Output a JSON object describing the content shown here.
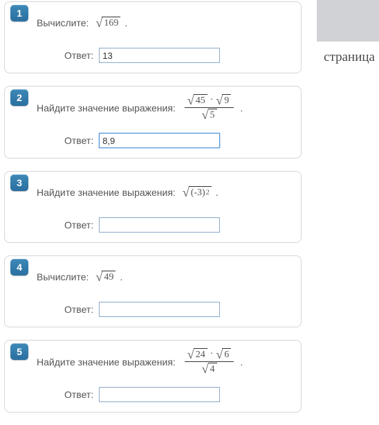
{
  "background": {
    "word": "страница"
  },
  "common": {
    "answer_label": "Ответ:"
  },
  "questions": [
    {
      "num": "1",
      "prompt": "Вычислите:",
      "formula": {
        "type": "sqrt",
        "arg": "169"
      },
      "answer": "13",
      "focused": false
    },
    {
      "num": "2",
      "prompt": "Найдите значение выражения:",
      "formula": {
        "type": "frac",
        "num": [
          {
            "type": "sqrt",
            "arg": "45"
          },
          {
            "type": "dot"
          },
          {
            "type": "sqrt",
            "arg": "9"
          }
        ],
        "den": [
          {
            "type": "sqrt",
            "arg": "5"
          }
        ]
      },
      "answer": "8,9",
      "focused": true
    },
    {
      "num": "3",
      "prompt": "Найдите значение выражения:",
      "formula": {
        "type": "sqrt_pow",
        "base": "(-3)",
        "exp": "2"
      },
      "answer": "",
      "focused": false
    },
    {
      "num": "4",
      "prompt": "Вычислите:",
      "formula": {
        "type": "sqrt",
        "arg": "49"
      },
      "answer": "",
      "focused": false
    },
    {
      "num": "5",
      "prompt": "Найдите значение выражения:",
      "formula": {
        "type": "frac",
        "num": [
          {
            "type": "sqrt",
            "arg": "24"
          },
          {
            "type": "dot"
          },
          {
            "type": "sqrt",
            "arg": "6"
          }
        ],
        "den": [
          {
            "type": "sqrt",
            "arg": "4"
          }
        ]
      },
      "answer": "",
      "focused": false
    }
  ]
}
